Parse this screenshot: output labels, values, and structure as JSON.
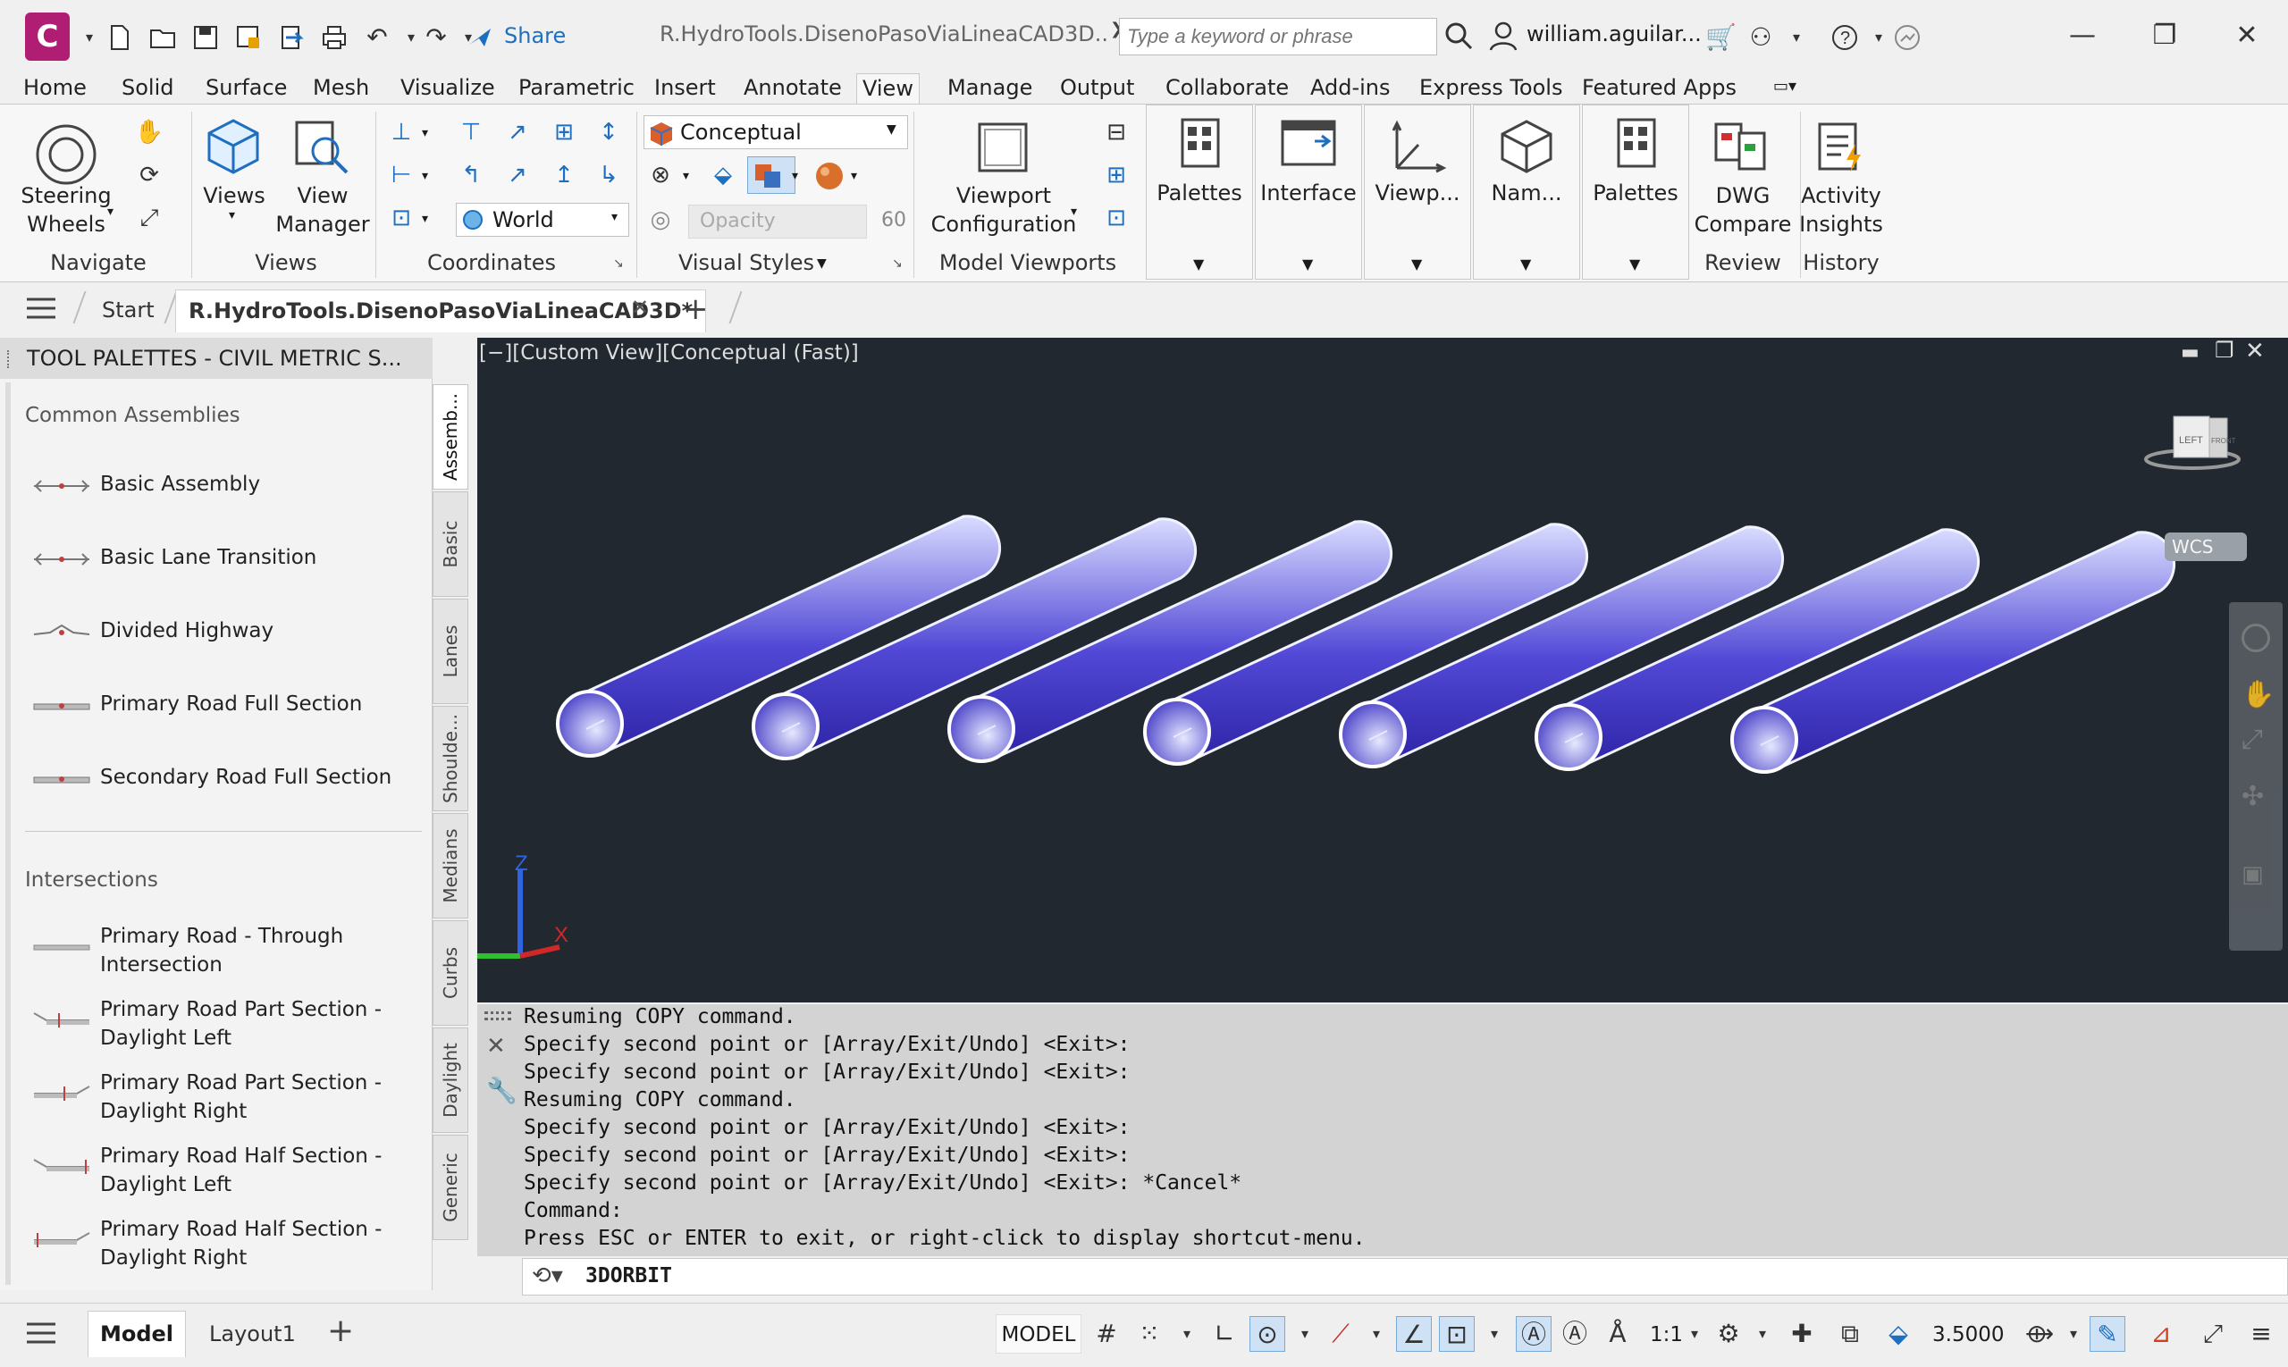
{
  "app": {
    "logo_letter": "C",
    "share_label": "Share",
    "title": "R.HydroTools.DisenoPasoViaLineaCAD3D....",
    "search_placeholder": "Type a keyword or phrase",
    "user": "william.aguilar..."
  },
  "menu_tabs": [
    "Home",
    "Solid",
    "Surface",
    "Mesh",
    "Visualize",
    "Parametric",
    "Insert",
    "Annotate",
    "View",
    "Manage",
    "Output",
    "Collaborate",
    "Add-ins",
    "Express Tools",
    "Featured Apps"
  ],
  "active_tab": "View",
  "ribbon": {
    "navigate": {
      "steering_wheels": "Steering\nWheels",
      "title": "Navigate"
    },
    "views": {
      "views_label": "Views",
      "view_manager": "View\nManager",
      "title": "Views"
    },
    "coordinates": {
      "ucs_world": "World",
      "title": "Coordinates"
    },
    "visual_styles": {
      "style": "Conceptual",
      "opacity_label": "Opacity",
      "opacity_value": "60",
      "title": "Visual Styles"
    },
    "model_viewports": {
      "viewport_config": "Viewport\nConfiguration",
      "title": "Model Viewports"
    },
    "palettes1": "Palettes",
    "interface": "Interface",
    "viewp": "Viewp...",
    "nam": "Nam...",
    "palettes2": "Palettes",
    "review": {
      "dwg_compare": "DWG\nCompare",
      "title": "Review"
    },
    "history": {
      "activity_insights": "Activity\nInsights",
      "title": "History"
    }
  },
  "file_tabs": {
    "start": "Start",
    "active": "R.HydroTools.DisenoPasoViaLineaCAD3D*"
  },
  "palette": {
    "header": "TOOL PALETTES - CIVIL METRIC S...",
    "common_title": "Common Assemblies",
    "common": [
      "Basic Assembly",
      "Basic Lane Transition",
      "Divided Highway",
      "Primary Road Full Section",
      "Secondary Road Full Section"
    ],
    "inter_title": "Intersections",
    "intersections": [
      "Primary Road - Through\nIntersection",
      "Primary Road Part Section -\nDaylight Left",
      "Primary Road Part Section -\nDaylight Right",
      "Primary Road Half Section -\nDaylight Left",
      "Primary Road Half Section -\nDaylight Right"
    ],
    "side_tabs": [
      "Assemb...",
      "Basic",
      "Lanes",
      "Shoulde...",
      "Medians",
      "Curbs",
      "Daylight",
      "Generic"
    ]
  },
  "viewport": {
    "label": "[−][Custom View][Conceptual (Fast)]",
    "viewcube_left": "LEFT",
    "viewcube_front": "FRONT",
    "wcs": "WCS",
    "axis_z": "Z",
    "axis_x": "X",
    "pipe_color": "#3b35c6"
  },
  "command": {
    "history": [
      "Resuming COPY command.",
      "Specify second point or [Array/Exit/Undo] <Exit>:",
      "Specify second point or [Array/Exit/Undo] <Exit>:",
      "Resuming COPY command.",
      "Specify second point or [Array/Exit/Undo] <Exit>:",
      "Specify second point or [Array/Exit/Undo] <Exit>:",
      "Specify second point or [Array/Exit/Undo] <Exit>: *Cancel*",
      "Command:",
      "Press ESC or ENTER to exit, or right-click to display shortcut-menu."
    ],
    "input": "3DORBIT"
  },
  "status": {
    "model_tab": "Model",
    "layout_tab": "Layout1",
    "model_button": "MODEL",
    "scale": "1:1",
    "value": "3.5000"
  }
}
